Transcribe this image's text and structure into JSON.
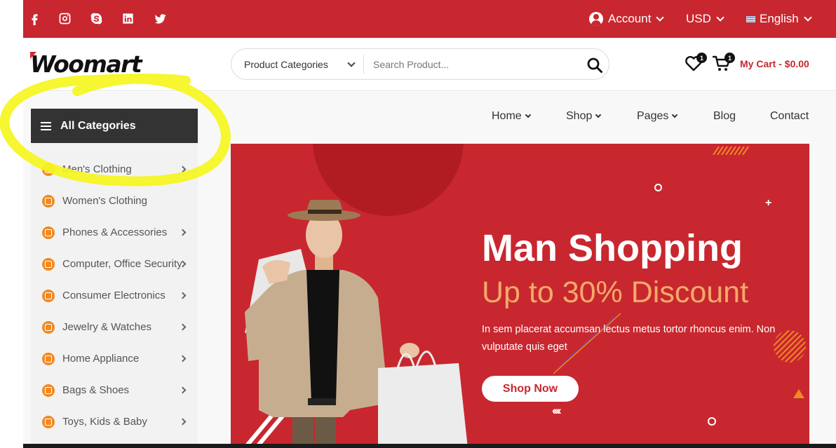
{
  "topbar": {
    "social_icons": [
      "facebook-icon",
      "instagram-icon",
      "skype-icon",
      "linkedin-icon",
      "twitter-icon"
    ],
    "account_label": "Account",
    "currency_label": "USD",
    "language_label": "English"
  },
  "header": {
    "logo_text": "Woomart",
    "search": {
      "category_label": "Product Categories",
      "placeholder": "Search Product..."
    },
    "wishlist_count": "1",
    "cart_count": "1",
    "cart_label": "My Cart - $0.00"
  },
  "sidebar": {
    "title": "All Categories",
    "items": [
      {
        "label": "Men's Clothing",
        "has_arrow": true
      },
      {
        "label": "Women's Clothing",
        "has_arrow": false
      },
      {
        "label": "Phones & Accessories",
        "has_arrow": true
      },
      {
        "label": "Computer, Office Security",
        "has_arrow": true
      },
      {
        "label": "Consumer Electronics",
        "has_arrow": true
      },
      {
        "label": "Jewelry & Watches",
        "has_arrow": true
      },
      {
        "label": "Home Appliance",
        "has_arrow": true
      },
      {
        "label": "Bags & Shoes",
        "has_arrow": true
      },
      {
        "label": "Toys, Kids & Baby",
        "has_arrow": true
      }
    ]
  },
  "nav": {
    "items": [
      {
        "label": "Home",
        "dropdown": true
      },
      {
        "label": "Shop",
        "dropdown": true
      },
      {
        "label": "Pages",
        "dropdown": true
      },
      {
        "label": "Blog",
        "dropdown": false
      },
      {
        "label": "Contact",
        "dropdown": false
      }
    ]
  },
  "banner": {
    "title": "Man Shopping",
    "subtitle": "Up to 30% Discount",
    "text": "In sem placerat accumsan lectus metus tortor rhoncus enim. Non vulputate quis eget",
    "button_label": "Shop Now"
  },
  "colors": {
    "brand_red": "#c8272f",
    "dark": "#333333",
    "accent_orange": "#f08a24",
    "highlight_yellow": "#f5f520"
  }
}
